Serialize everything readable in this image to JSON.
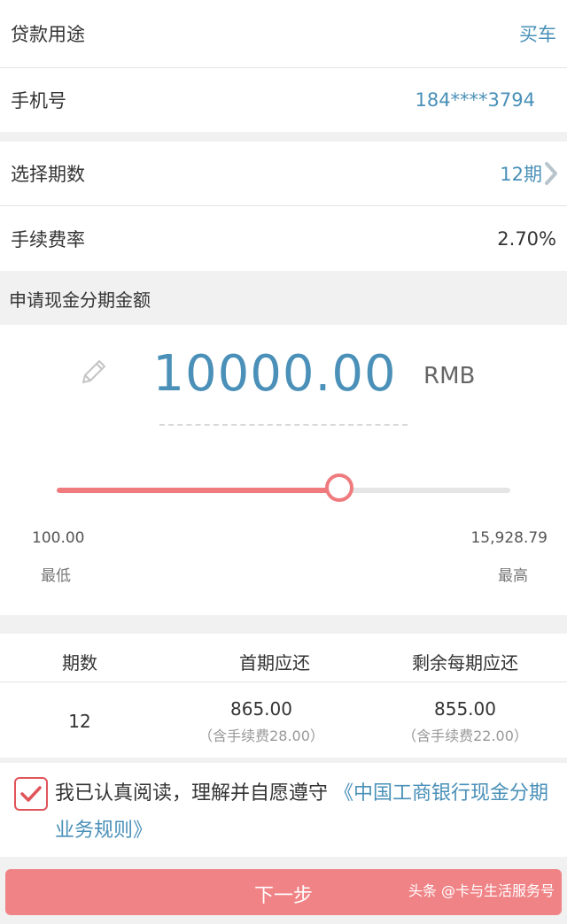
{
  "loan_purpose": {
    "label": "贷款用途",
    "value": "买车"
  },
  "phone": {
    "label": "手机号",
    "value": "184****3794"
  },
  "period": {
    "label": "选择期数",
    "value": "12期"
  },
  "fee_rate": {
    "label": "手续费率",
    "value": "2.70%"
  },
  "amount_section": {
    "title": "申请现金分期金额",
    "amount": "10000.00",
    "currency": "RMB",
    "slider_fraction": 0.623,
    "min_value": "100.00",
    "min_label": "最低",
    "max_value": "15,928.79",
    "max_label": "最高"
  },
  "table": {
    "headers": [
      "期数",
      "首期应还",
      "剩余每期应还"
    ],
    "periods": "12",
    "first_payment": "865.00",
    "first_fee": "（含手续费28.00）",
    "remaining_payment": "855.00",
    "remaining_fee": "（含手续费22.00）"
  },
  "agreement": {
    "text": "我已认真阅读，理解并自愿遵守",
    "link": "《中国工商银行现金分期业务规则》",
    "checked": true
  },
  "next_button": "下一步",
  "watermark": "头条 @卡与生活服务号",
  "colors": {
    "accent_blue": "#4a90b8",
    "accent_red": "#ef7b7e"
  }
}
